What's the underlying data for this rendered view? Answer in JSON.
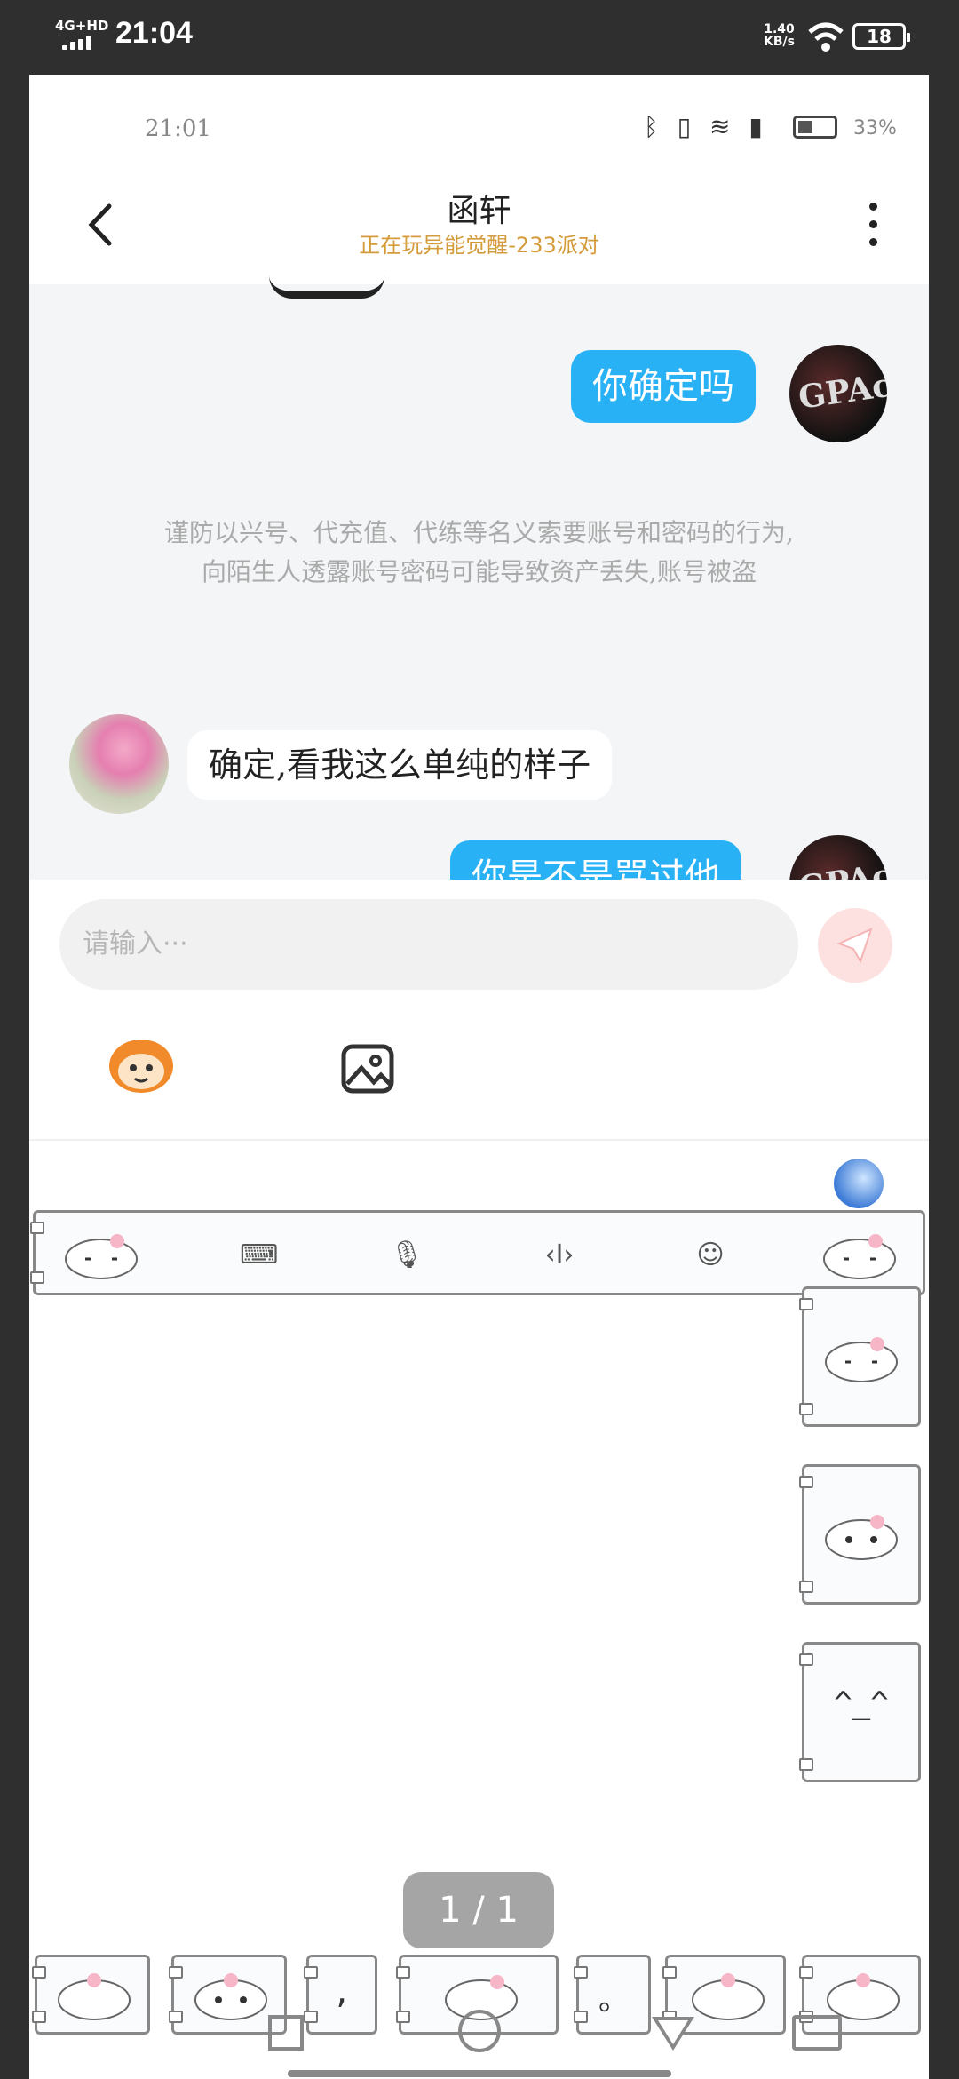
{
  "outer_status": {
    "network": "4G+HD",
    "time": "21:04",
    "speed_value": "1.40",
    "speed_unit": "KB/s",
    "battery": "18"
  },
  "inner_status": {
    "time": "21:01",
    "battery_pct": "33%"
  },
  "header": {
    "name": "函轩",
    "subtitle": "正在玩异能觉醒-233派对"
  },
  "messages": [
    {
      "from": "me",
      "text": "你确定吗"
    },
    {
      "from": "other",
      "text": "确定,看我这么单纯的样子"
    },
    {
      "from": "me",
      "text": "你是不是骂过他"
    }
  ],
  "warning": {
    "line1": "谨防以兴号、代充值、代练等名义索要账号和密码的行为,",
    "line2": "向陌生人透露账号密码可能导致资产丢失,账号被盗"
  },
  "input": {
    "placeholder": "请输入···"
  },
  "keyboard": {
    "side_cards": [
      "",
      "",
      "^_^"
    ],
    "bottom_row": [
      "",
      "",
      ",",
      "",
      "。",
      "",
      ""
    ]
  },
  "page_indicator": "1 / 1"
}
